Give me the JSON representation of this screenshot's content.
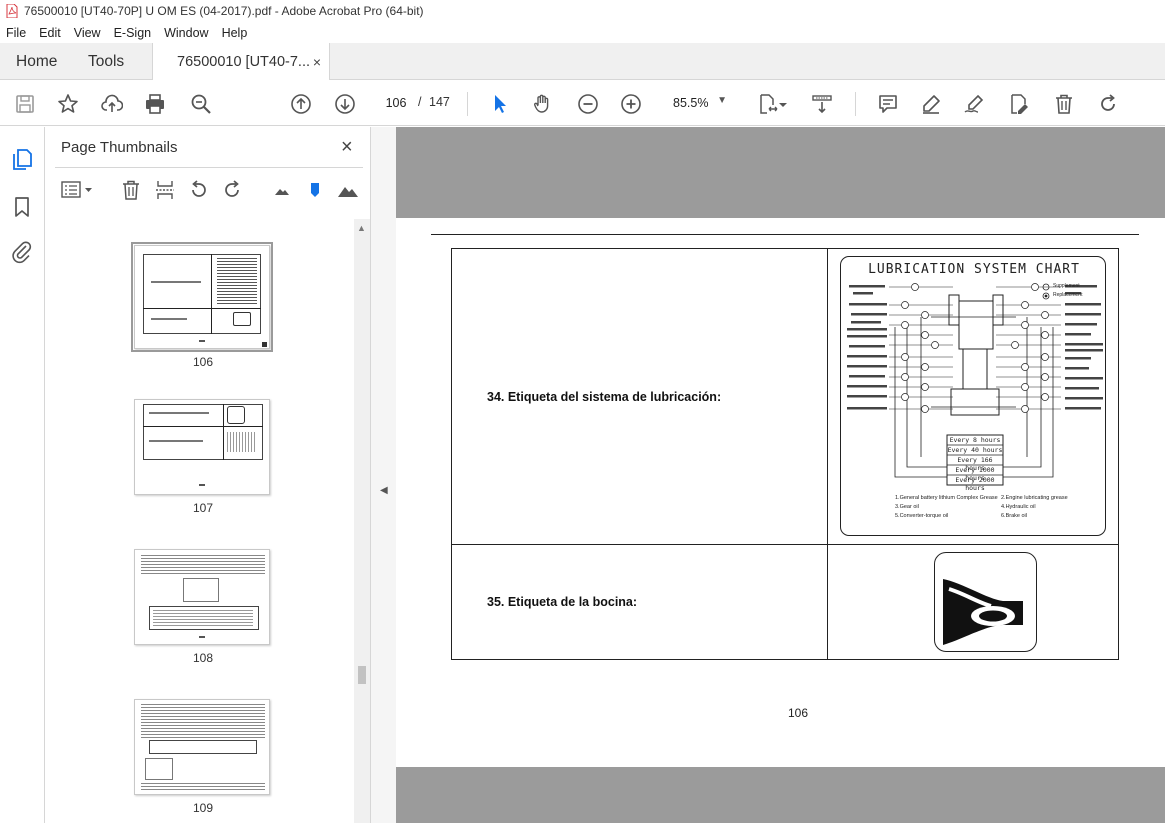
{
  "window": {
    "title": "76500010 [UT40-70P] U OM ES (04-2017).pdf - Adobe Acrobat Pro (64-bit)"
  },
  "menu": [
    "File",
    "Edit",
    "View",
    "E-Sign",
    "Window",
    "Help"
  ],
  "tabs": {
    "home": "Home",
    "tools": "Tools",
    "document": "76500010 [UT40-7...",
    "close_glyph": "×"
  },
  "toolbar": {
    "page_current": "106",
    "page_separator": "/",
    "page_total": "147",
    "zoom": "85.5%"
  },
  "thumbnails_panel": {
    "title": "Page Thumbnails",
    "close_glyph": "×",
    "pages": [
      {
        "label": "106",
        "selected": true
      },
      {
        "label": "107",
        "selected": false
      },
      {
        "label": "108",
        "selected": false
      },
      {
        "label": "109",
        "selected": false
      }
    ]
  },
  "document_page": {
    "rows": [
      {
        "label": "34. Etiqueta del sistema de lubricación:"
      },
      {
        "label": "35. Etiqueta de la bocina:"
      }
    ],
    "page_number": "106",
    "lubrication_chart": {
      "title": "LUBRICATION SYSTEM CHART",
      "legend": [
        "Supplement",
        "Replacement"
      ],
      "intervals": [
        "Every 8 hours",
        "Every 40 hours",
        "Every 166 hours",
        "Every 1000 hours",
        "Every 2000 hours"
      ],
      "notes": [
        "1.General battery lithium Complex Grease",
        "2.Engine lubricating grease",
        "3.Gear oil",
        "4.Hydraulic oil",
        "5.Converter-torque oil",
        "6.Brake oil"
      ]
    }
  },
  "colors": {
    "accent": "#1473e6",
    "viewport_bg": "#9b9b9b",
    "tab_bar_bg": "#f0f0f0"
  }
}
